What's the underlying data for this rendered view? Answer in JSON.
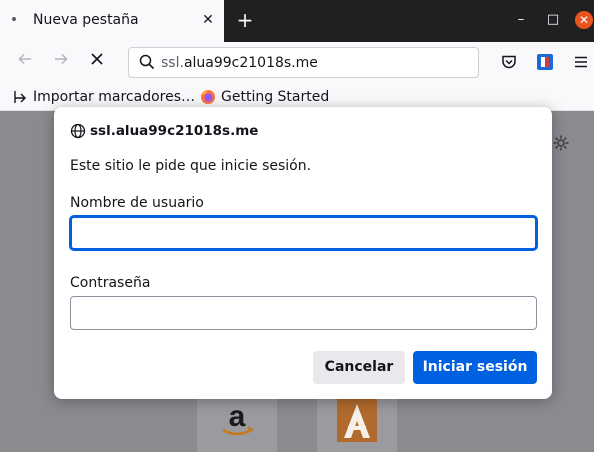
{
  "browser": {
    "tab": {
      "title": "Nueva pestaña",
      "close_symbol": "✕"
    },
    "new_tab_symbol": "+",
    "window_controls": {
      "minimize": "–",
      "maximize": "□",
      "close": "✕"
    },
    "url": {
      "prefix": "ssl.",
      "domain": "alua99c21018s.me"
    },
    "bookmarks": [
      {
        "label": "Importar marcadores…",
        "icon": "import-icon"
      },
      {
        "label": "Getting Started",
        "icon": "firefox-icon"
      }
    ]
  },
  "dialog": {
    "host": "ssl.alua99c21018s.me",
    "message": "Este sitio le pide que inicie sesión.",
    "username_label": "Nombre de usuario",
    "username_value": "",
    "password_label": "Contraseña",
    "password_value": "",
    "cancel_label": "Cancelar",
    "signin_label": "Iniciar sesión"
  },
  "colors": {
    "accent": "#0061e0",
    "window_close": "#e95420",
    "tab_strip": "#202023"
  }
}
